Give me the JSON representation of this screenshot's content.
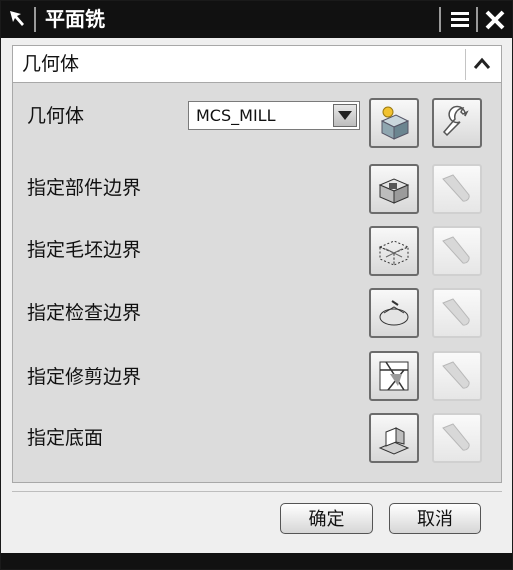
{
  "window": {
    "title": "平面铣"
  },
  "section": {
    "title": "几何体"
  },
  "geometry": {
    "label": "几何体",
    "select_value": "MCS_MILL"
  },
  "rows": [
    {
      "label": "指定部件边界",
      "icon": "part-boundary-icon"
    },
    {
      "label": "指定毛坯边界",
      "icon": "blank-boundary-icon"
    },
    {
      "label": "指定检查边界",
      "icon": "check-boundary-icon"
    },
    {
      "label": "指定修剪边界",
      "icon": "trim-boundary-icon"
    },
    {
      "label": "指定底面",
      "icon": "floor-plane-icon"
    }
  ],
  "buttons": {
    "ok": "确定",
    "cancel": "取消"
  },
  "icons": {
    "titlebar": [
      "arrow-icon",
      "menu-icon",
      "close-icon"
    ],
    "section": "collapse-up-icon",
    "geometry": [
      "new-geometry-icon",
      "edit-wrench-icon"
    ],
    "display": "flashlight-display-icon"
  },
  "colors": {
    "titlebar": "#111111",
    "panel": "#dcdcdc",
    "window": "#efefef"
  }
}
